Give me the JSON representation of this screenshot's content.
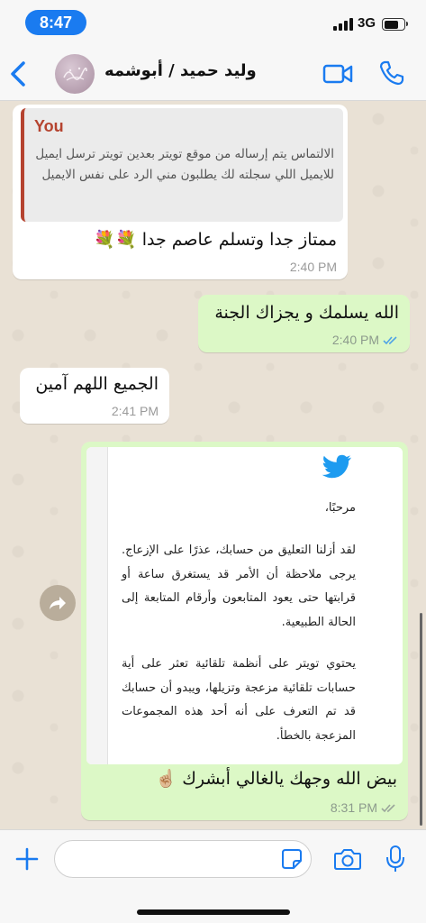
{
  "status_bar": {
    "time": "8:47",
    "network": "3G",
    "battery_level": 0.75
  },
  "header": {
    "contact_name": "وليد حميد / أبوشمه",
    "avatar_text": "",
    "accent_color": "#1a7bf0"
  },
  "messages": [
    {
      "direction": "incoming",
      "quote": {
        "author": "You",
        "text": "الالتماس يتم إرساله من موقع تويتر بعدين تويتر ترسل ايميل للايميل اللي سجلته لك يطلبون مني الرد على نفس الايميل"
      },
      "text": "ممتاز جدا وتسلم  عاصم جدا 💐💐",
      "time": "2:40 PM"
    },
    {
      "direction": "outgoing",
      "text": "الله يسلمك و يجزاك الجنة",
      "time": "2:40 PM",
      "status": "read"
    },
    {
      "direction": "incoming",
      "text": "الجميع اللهم آمين",
      "time": "2:41 PM"
    },
    {
      "direction": "outgoing",
      "image": {
        "logo": "twitter-bird-icon",
        "greeting": "مرحبًا،",
        "paragraph_1": "لقد أزلنا التعليق من حسابك، عذرًا على الإزعاج. يرجى ملاحظة أن الأمر قد يستغرق ساعة أو قرابتها حتى يعود المتابعون وأرقام المتابعة إلى الحالة الطبيعية.",
        "paragraph_2": "يحتوي تويتر على أنظمة تلقائية تعثر على أية حسابات تلقائية مزعجة وتزيلها، ويبدو أن حسابك قد تم التعرف على أنه أحد هذه المجموعات المزعجة بالخطأ."
      },
      "text": "بيض الله وجهك يالغالي أبشرك ☝🏼",
      "time": "8:31 PM",
      "status": "delivered"
    }
  ],
  "input_bar": {
    "placeholder": "",
    "value": ""
  },
  "colors": {
    "outgoing_bubble": "#dcf8c6",
    "incoming_bubble": "#ffffff",
    "quote_author": "#b5432f",
    "read_ticks": "#4fa3e6",
    "delivered_ticks": "#9aa59a"
  }
}
